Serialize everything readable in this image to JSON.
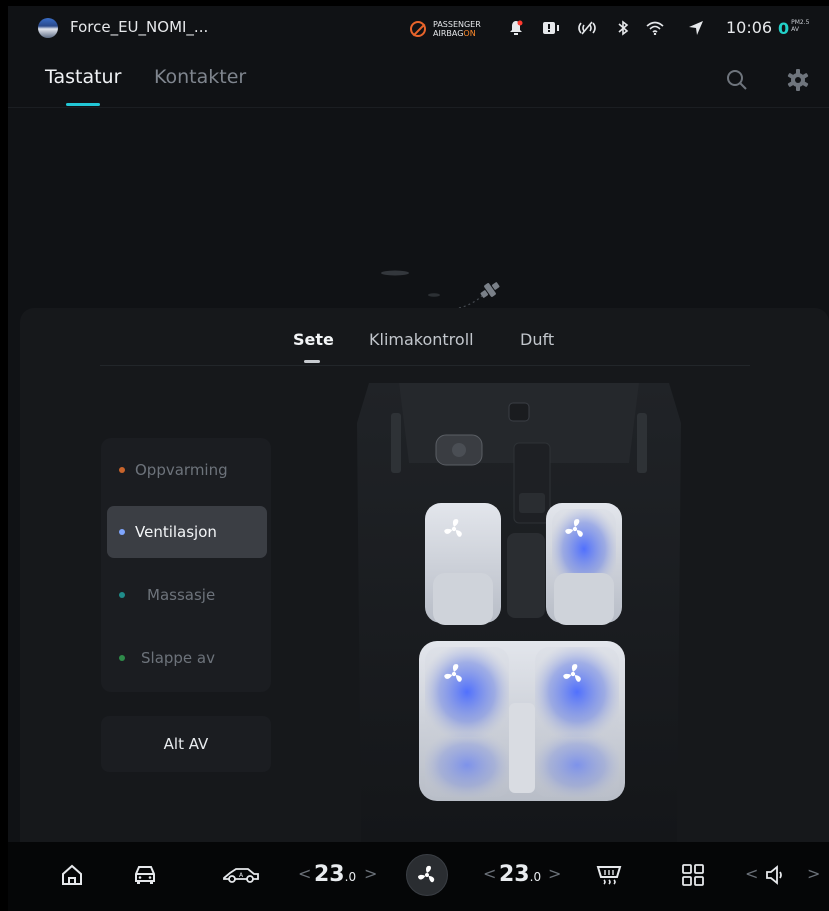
{
  "status_bar": {
    "profile_name": "Force_EU_NOMI_...",
    "airbag_line1": "PASSENGER",
    "airbag_line2": "AIRBAG",
    "airbag_state": "ON",
    "time": "10:06",
    "pm_value": "0",
    "pm_label": "PM2.5",
    "pm_sub": "AV",
    "icons": [
      "passenger-airbag-icon",
      "bell-icon",
      "screen-mirror-icon",
      "no-signal-icon",
      "bluetooth-icon",
      "wifi-icon",
      "navigation-icon"
    ]
  },
  "header": {
    "tabs": [
      {
        "label": "Tastatur",
        "active": true
      },
      {
        "label": "Kontakter",
        "active": false
      }
    ],
    "icons": [
      "search-icon",
      "gear-icon"
    ]
  },
  "panel": {
    "tabs": [
      {
        "label": "Sete",
        "active": true
      },
      {
        "label": "Klimakontroll",
        "active": false
      },
      {
        "label": "Duft",
        "active": false
      }
    ],
    "menu": [
      {
        "label": "Oppvarming",
        "dot_color": "#c8642b",
        "selected": false
      },
      {
        "label": "Ventilasjon",
        "dot_color": "#7fa6ff",
        "selected": true
      },
      {
        "label": "Massasje",
        "dot_color": "#1f8c8a",
        "selected": false
      },
      {
        "label": "Slappe av",
        "dot_color": "#2e8b4a",
        "selected": false
      }
    ],
    "all_off_label": "Alt AV"
  },
  "dock": {
    "left_temp": "23",
    "left_temp_decimal": ".0",
    "right_temp": "23",
    "right_temp_decimal": ".0",
    "arrow_left": "<",
    "arrow_right": ">",
    "icons": [
      "home-icon",
      "car-icon",
      "car-side-icon",
      "fan-icon",
      "rear-defrost-icon",
      "apps-grid-icon",
      "volume-icon"
    ]
  },
  "colors": {
    "accent": "#22c7d6",
    "airbag_on": "#ff8a2b",
    "ventilation_glow": "#3f62ff"
  }
}
